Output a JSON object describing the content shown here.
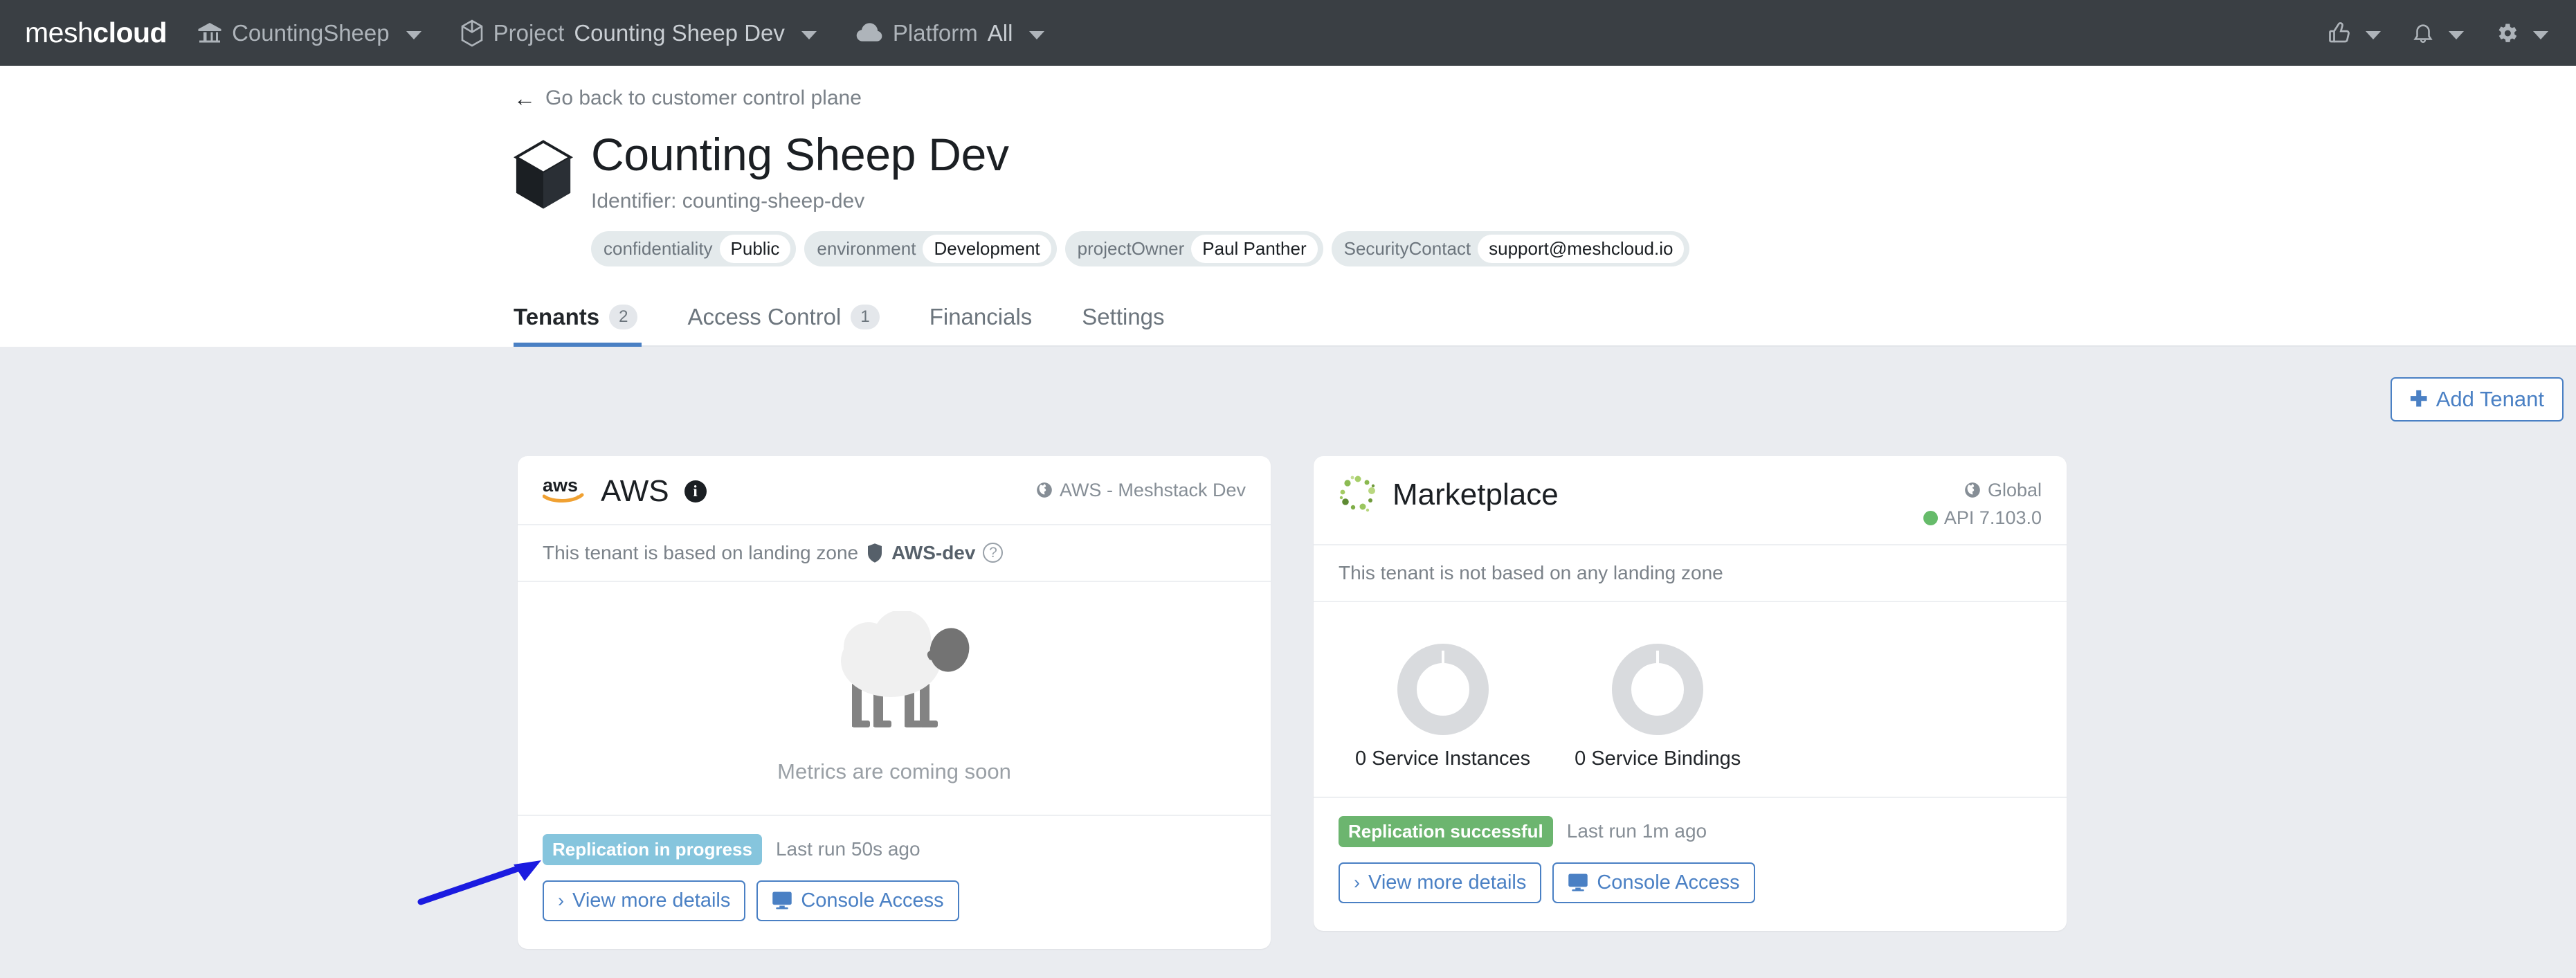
{
  "navbar": {
    "brand_light": "mesh",
    "brand_bold": "cloud",
    "org": {
      "icon": "bank-icon",
      "label": "CountingSheep"
    },
    "project": {
      "icon": "cube-icon",
      "label": "Project",
      "value": "Counting Sheep Dev"
    },
    "platform": {
      "icon": "cloud-icon",
      "label": "Platform",
      "value": "All"
    },
    "right_icons": [
      {
        "name": "thumbs-up-icon",
        "label": ""
      },
      {
        "name": "bell-icon",
        "label": ""
      },
      {
        "name": "gear-icon",
        "label": ""
      }
    ]
  },
  "header": {
    "back_link": "Go back to customer control plane",
    "title": "Counting Sheep Dev",
    "identifier": "Identifier: counting-sheep-dev",
    "tags": [
      {
        "key": "confidentiality",
        "value": "Public"
      },
      {
        "key": "environment",
        "value": "Development"
      },
      {
        "key": "projectOwner",
        "value": "Paul Panther"
      },
      {
        "key": "SecurityContact",
        "value": "support@meshcloud.io"
      }
    ]
  },
  "tabs": [
    {
      "label": "Tenants",
      "badge": "2",
      "active": true
    },
    {
      "label": "Access Control",
      "badge": "1",
      "active": false
    },
    {
      "label": "Financials",
      "badge": "",
      "active": false
    },
    {
      "label": "Settings",
      "badge": "",
      "active": false
    }
  ],
  "toolbar": {
    "add_tenant_label": "Add Tenant",
    "add_tenant_icon": "plus-icon"
  },
  "cards": [
    {
      "logo": "aws-logo",
      "title": "AWS",
      "info_icon": "info-icon",
      "location": "AWS - Meshstack Dev",
      "location_icon": "globe-icon",
      "api_version": "",
      "landing_zone_prefix": "This tenant is based on landing zone",
      "landing_zone_name": "AWS-dev",
      "landing_zone_icon": "shield-icon",
      "landing_zone_help": "?",
      "metrics_note": "Metrics are coming soon",
      "illustration": "sheep-illustration",
      "status_badge": "Replication in progress",
      "status_color": "#86c5dd",
      "last_run": "Last run 50s ago",
      "view_details_label": "View more details",
      "console_access_label": "Console Access",
      "console_icon": "monitor-icon"
    },
    {
      "logo": "marketplace-logo",
      "title": "Marketplace",
      "info_icon": "",
      "location": "Global",
      "location_icon": "globe-icon",
      "api_version": "API 7.103.0",
      "landing_zone_prefix": "This tenant is not based on any landing zone",
      "landing_zone_name": "",
      "landing_zone_icon": "",
      "landing_zone_help": "",
      "metrics_note": "",
      "illustration": "donut-charts",
      "status_badge": "Replication successful",
      "status_color": "#6cb56f",
      "last_run": "Last run 1m ago",
      "view_details_label": "View more details",
      "console_access_label": "Console Access",
      "console_icon": "monitor-icon"
    }
  ],
  "chart_data": [
    {
      "type": "pie",
      "title": "0 Service Instances",
      "categories": [
        "empty"
      ],
      "values": [
        0
      ],
      "total": 0,
      "colors": [
        "#d9dbde"
      ]
    },
    {
      "type": "pie",
      "title": "0 Service Bindings",
      "categories": [
        "empty"
      ],
      "values": [
        0
      ],
      "total": 0,
      "colors": [
        "#d9dbde"
      ]
    }
  ],
  "annotation": {
    "arrow_color": "#1b1be0",
    "points_to": "status_badge_aws"
  }
}
